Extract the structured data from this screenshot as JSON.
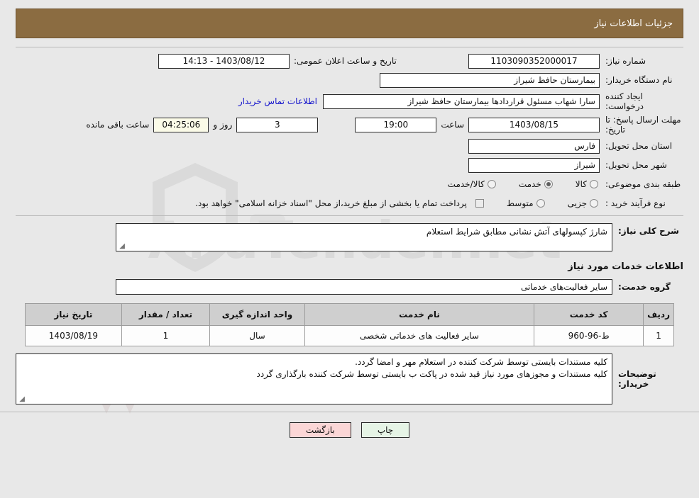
{
  "header": {
    "title": "جزئیات اطلاعات نیاز",
    "bar_color": "#8b6c41",
    "title_color": "#ffffff"
  },
  "summary": {
    "need_number_label": "شماره نیاز:",
    "need_number_value": "1103090352000017",
    "public_announce_label": "تاریخ و ساعت اعلان عمومی:",
    "public_announce_value": "1403/08/12 - 14:13",
    "buyer_org_label": "نام دستگاه خریدار:",
    "buyer_org_value": "بیمارستان حافظ شیراز",
    "creator_label": "ایجاد کننده درخواست:",
    "creator_value": "سارا شهاب مسئول قراردادها بیمارستان حافظ شیراز",
    "contact_link": "اطلاعات تماس خریدار",
    "contact_link_color": "#1414cc",
    "deadline_label": "مهلت ارسال پاسخ: تا تاریخ:",
    "deadline_date": "1403/08/15",
    "deadline_hour_label": "ساعت",
    "deadline_hour_value": "19:00",
    "remaining_days_value": "3",
    "remaining_days_label": "روز و",
    "remaining_time_value": "04:25:06",
    "remaining_time_label": "ساعت باقی مانده",
    "province_label": "استان محل تحویل:",
    "province_value": "فارس",
    "city_label": "شهر محل تحویل:",
    "city_value": "شیراز",
    "classification_label": "طبقه بندی موضوعی:",
    "classification_options": [
      {
        "label": "کالا",
        "checked": false
      },
      {
        "label": "خدمت",
        "checked": true
      },
      {
        "label": "کالا/خدمت",
        "checked": false
      }
    ],
    "process_label": "نوع فرآیند خرید :",
    "process_options": [
      {
        "label": "جزیی",
        "checked": false
      },
      {
        "label": "متوسط",
        "checked": false
      }
    ],
    "treasury_checkbox_checked": false,
    "treasury_note": "پرداخت تمام یا بخشی از مبلغ خرید،از محل \"اسناد خزانه اسلامی\" خواهد بود."
  },
  "description": {
    "label": "شرح کلی نیاز:",
    "value": "شارژ کپسولهای آتش نشانی مطابق شرایط استعلام"
  },
  "services_section": {
    "title": "اطلاعات خدمات مورد نیاز",
    "group_label": "گروه خدمت:",
    "group_value": "سایر فعالیت‌های خدماتی"
  },
  "items_table": {
    "columns": [
      "ردیف",
      "کد خدمت",
      "نام خدمت",
      "واحد اندازه گیری",
      "تعداد / مقدار",
      "تاریخ نیاز"
    ],
    "rows": [
      {
        "radif": "1",
        "code": "ط-96-960",
        "name": "سایر فعالیت های خدماتی شخصی",
        "unit": "سال",
        "qty": "1",
        "date": "1403/08/19"
      }
    ]
  },
  "buyer_notes": {
    "label": "توضیحات خریدار:",
    "lines": [
      "کلیه مستندات بایستی توسط شرکت کننده در استعلام مهر و امضا گردد.",
      "کلیه مستندات و مجوزهای  مورد نیاز قید شده در پاکت ب بایستی توسط شرکت کننده بارگذاری گردد"
    ]
  },
  "footer": {
    "print_label": "چاپ",
    "back_label": "بازگشت",
    "print_color": "#e6f4e6",
    "back_color": "#fbd6d6"
  },
  "watermark": {
    "text": "AnaTender.net"
  }
}
